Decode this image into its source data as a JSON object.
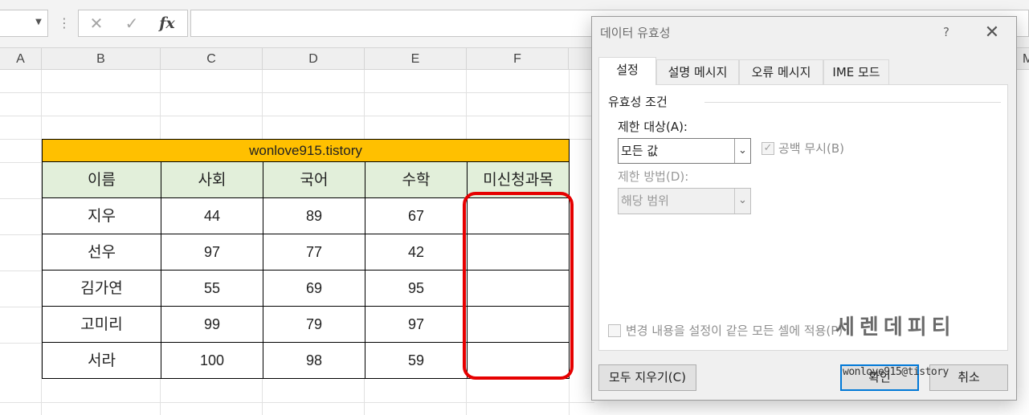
{
  "formula_bar": {
    "namebox_value": "",
    "cancel_icon": "✕",
    "enter_icon": "✓",
    "function_icon": "fx",
    "formula_value": ""
  },
  "columns": [
    "A",
    "B",
    "C",
    "D",
    "E",
    "F",
    "M"
  ],
  "table": {
    "title": "wonlove915.tistory",
    "title_color": "#ffc000",
    "header_color": "#e2efda",
    "headers": [
      "이름",
      "사회",
      "국어",
      "수학",
      "미신청과목"
    ],
    "rows": [
      [
        "지우",
        "44",
        "89",
        "67",
        ""
      ],
      [
        "선우",
        "97",
        "77",
        "42",
        ""
      ],
      [
        "김가연",
        "55",
        "69",
        "95",
        ""
      ],
      [
        "고미리",
        "99",
        "79",
        "97",
        ""
      ],
      [
        "서라",
        "100",
        "98",
        "59",
        ""
      ]
    ],
    "highlight_color": "#e60000"
  },
  "dialog": {
    "title": "데이터 유효성",
    "help": "?",
    "close": "✕",
    "tabs": [
      "설정",
      "설명 메시지",
      "오류 메시지",
      "IME 모드"
    ],
    "active_tab": "설정",
    "group_label": "유효성 조건",
    "allow_label": "제한 대상(A):",
    "allow_value": "모든 값",
    "ignore_blank_label": "공백 무시(B)",
    "ignore_blank_checked": true,
    "data_label": "제한 방법(D):",
    "data_value": "해당 범위",
    "apply_label": "변경 내용을 설정이 같은 모든 셀에 적용(P)",
    "apply_checked": false,
    "clear_button": "모두 지우기(C)",
    "ok_button": "확인",
    "cancel_button": "취소"
  },
  "watermark": {
    "text": "세렌데피티",
    "url": "wonlove915@tistory"
  }
}
